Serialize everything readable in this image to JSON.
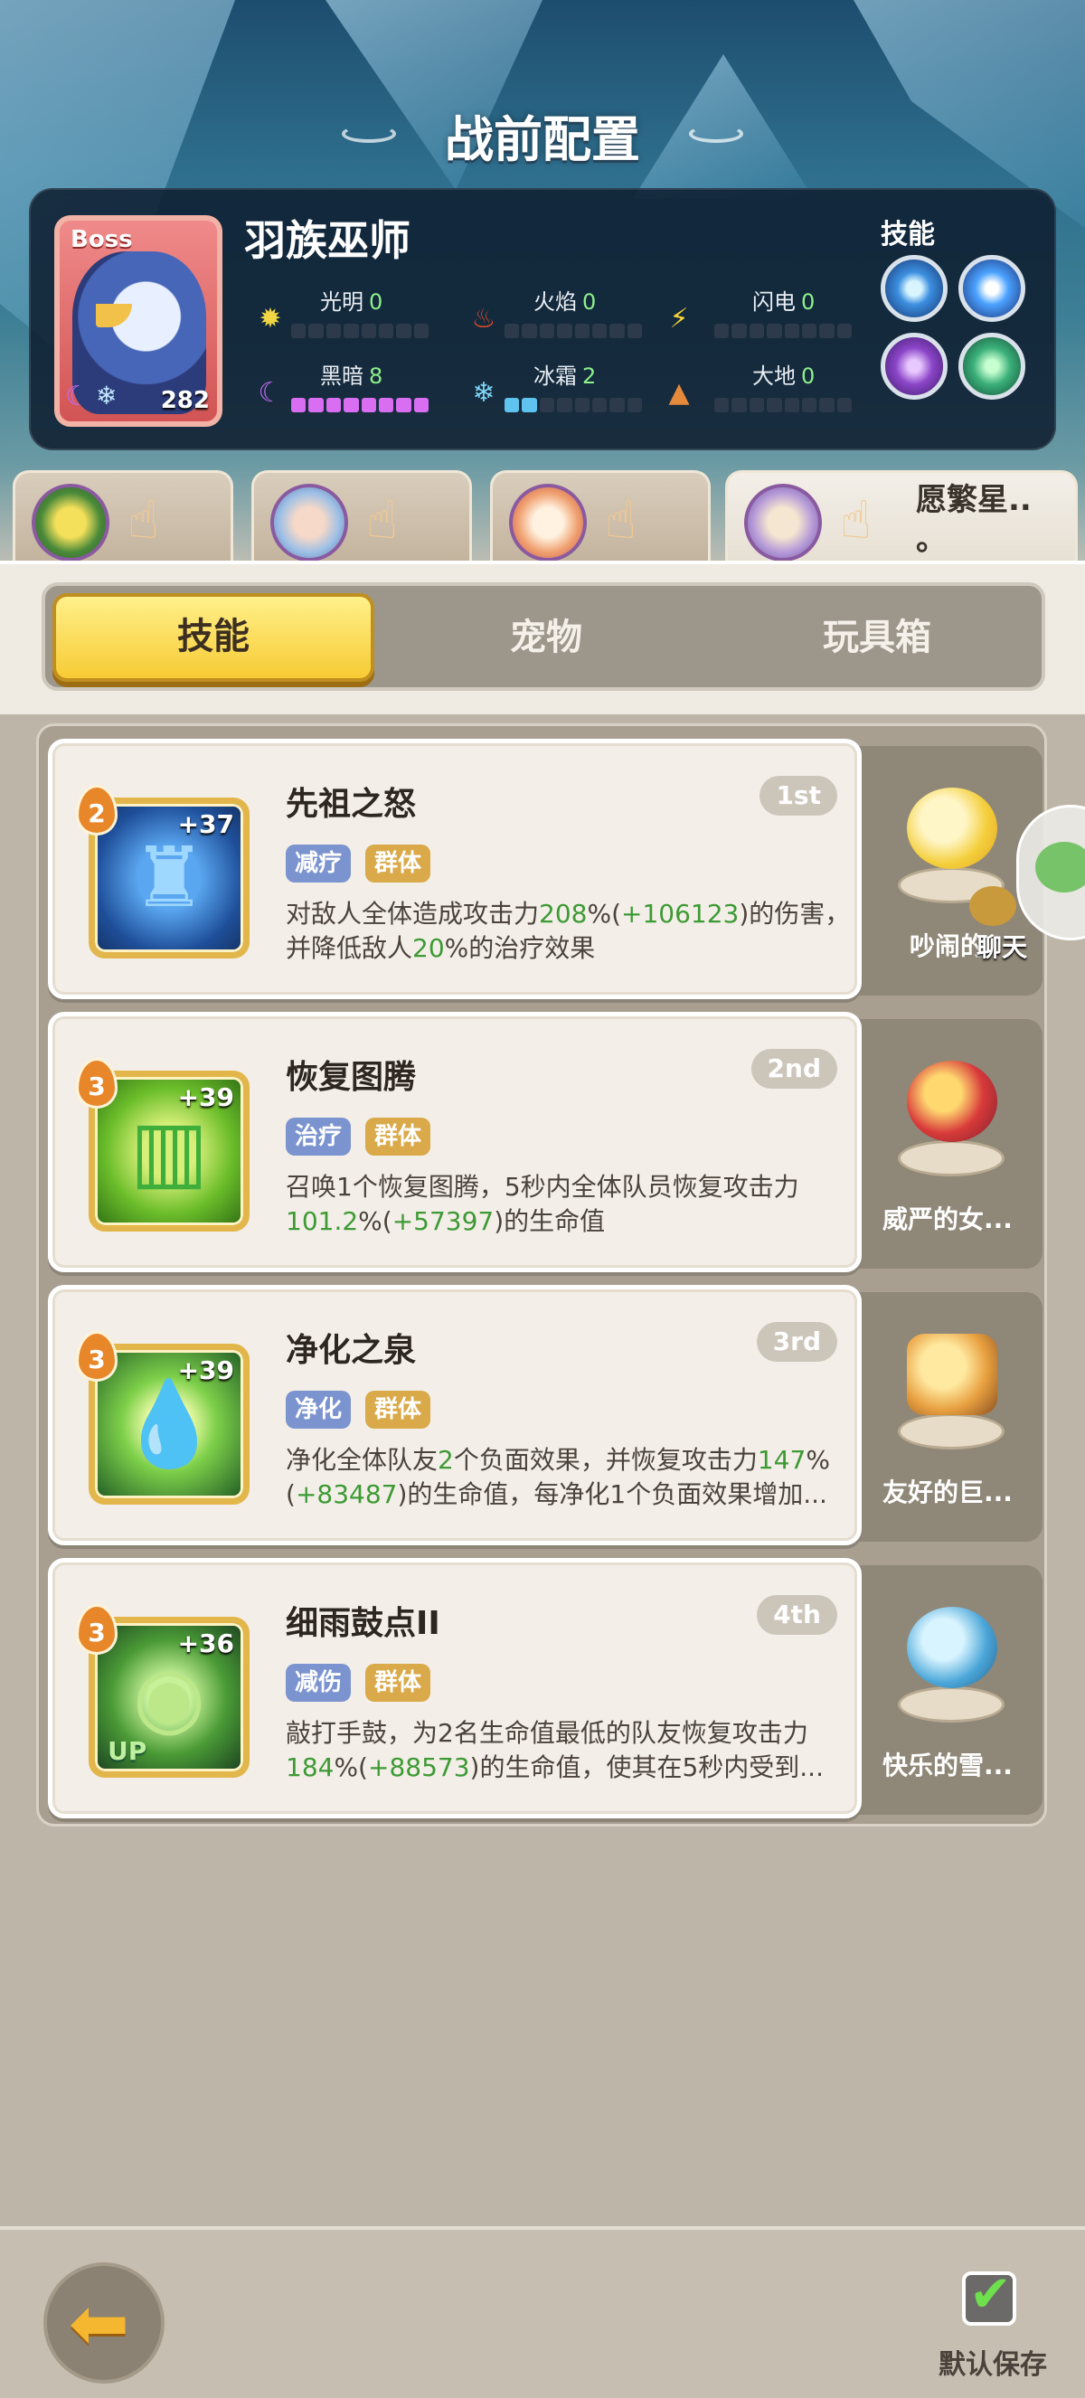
{
  "header": {
    "title": "战前配置"
  },
  "boss": {
    "badge": "Boss",
    "name": "羽族巫师",
    "level": "282",
    "elements": [
      {
        "id": "light",
        "label": "光明",
        "value": "0",
        "filled": 0
      },
      {
        "id": "fire",
        "label": "火焰",
        "value": "0",
        "filled": 0
      },
      {
        "id": "thunder",
        "label": "闪电",
        "value": "0",
        "filled": 0
      },
      {
        "id": "dark",
        "label": "黑暗",
        "value": "8",
        "filled": 8
      },
      {
        "id": "frost",
        "label": "冰霜",
        "value": "2",
        "filled": 2
      },
      {
        "id": "earth",
        "label": "大地",
        "value": "0",
        "filled": 0
      }
    ],
    "skills_label": "技能"
  },
  "teammates": [
    {
      "name": ""
    },
    {
      "name": ""
    },
    {
      "name": ""
    },
    {
      "name": "愿繁星..",
      "name2": "。"
    }
  ],
  "tabs": {
    "skills": "技能",
    "pets": "宠物",
    "toybox": "玩具箱"
  },
  "skills": [
    {
      "level": "2",
      "bonus": "+37",
      "name": "先祖之怒",
      "rank": "1st",
      "tag1": "减疗",
      "tag2": "群体",
      "desc_a": "对敌人全体造成攻击力",
      "desc_v1": "208",
      "desc_b": "%(",
      "desc_v2": "+106123",
      "desc_c": ")的伤害，并降低敌人",
      "desc_v3": "20",
      "desc_d": "%的治疗效果",
      "pet_name": "吵闹的"
    },
    {
      "level": "3",
      "bonus": "+39",
      "name": "恢复图腾",
      "rank": "2nd",
      "tag1": "治疗",
      "tag2": "群体",
      "desc_a": "召唤1个恢复图腾，5秒内全体队员恢复攻击力",
      "desc_v1": "101.2",
      "desc_b": "%(",
      "desc_v2": "+57397",
      "desc_c": ")的生命值",
      "desc_v3": "",
      "desc_d": "",
      "pet_name": "威严的女..."
    },
    {
      "level": "3",
      "bonus": "+39",
      "name": "净化之泉",
      "rank": "3rd",
      "tag1": "净化",
      "tag2": "群体",
      "desc_a": "净化全体队友",
      "desc_v1": "2",
      "desc_b": "个负面效果，并恢复攻击力",
      "desc_v2": "147",
      "desc_c": "%(",
      "desc_v3": "+83487",
      "desc_d": ")的生命值，每净化1个负面效果增加...",
      "pet_name": "友好的巨..."
    },
    {
      "level": "3",
      "bonus": "+36",
      "name": "细雨鼓点II",
      "rank": "4th",
      "tag1": "减伤",
      "tag2": "群体",
      "desc_a": "敲打手鼓，为2名生命值最低的队友恢复攻击力",
      "desc_v1": "184",
      "desc_b": "%(",
      "desc_v2": "+88573",
      "desc_c": ")的生命值，使其在5秒内受到...",
      "desc_v3": "",
      "desc_d": "",
      "pet_name": "快乐的雪..."
    }
  ],
  "chat": {
    "label": "聊天"
  },
  "bottom": {
    "save_label": "默认保存"
  },
  "colors": {
    "accent_yellow": "#f7cb34",
    "value_green": "#3d9a34",
    "dark_bar": "#d96ef2",
    "frost_bar": "#5fc3f0"
  }
}
